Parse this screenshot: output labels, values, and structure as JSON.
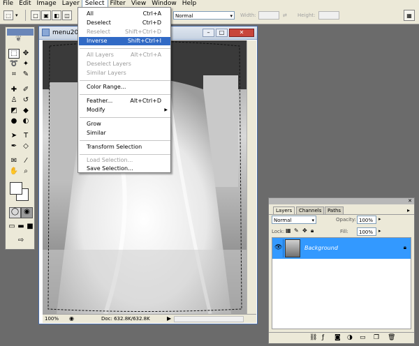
{
  "menubar": {
    "items": [
      "File",
      "Edit",
      "Image",
      "Layer",
      "Select",
      "Filter",
      "View",
      "Window",
      "Help"
    ],
    "active": "Select"
  },
  "options": {
    "style_value": "Normal",
    "width_label": "Width:",
    "height_label": "Height:"
  },
  "document": {
    "title": "menu20",
    "zoom": "100%",
    "doc_info": "Doc: 632.8K/632.8K"
  },
  "select_menu": {
    "items": [
      {
        "label": "All",
        "shortcut": "Ctrl+A",
        "enabled": true
      },
      {
        "label": "Deselect",
        "shortcut": "Ctrl+D",
        "enabled": true
      },
      {
        "label": "Reselect",
        "shortcut": "Shift+Ctrl+D",
        "enabled": false
      },
      {
        "label": "Inverse",
        "shortcut": "Shift+Ctrl+I",
        "enabled": true,
        "highlighted": true
      },
      {
        "label": "All Layers",
        "shortcut": "Alt+Ctrl+A",
        "enabled": false
      },
      {
        "label": "Deselect Layers",
        "shortcut": "",
        "enabled": false
      },
      {
        "label": "Similar Layers",
        "shortcut": "",
        "enabled": false
      },
      {
        "label": "Color Range...",
        "shortcut": "",
        "enabled": true
      },
      {
        "label": "Feather...",
        "shortcut": "Alt+Ctrl+D",
        "enabled": true
      },
      {
        "label": "Modify",
        "shortcut": "",
        "enabled": true,
        "submenu": true
      },
      {
        "label": "Grow",
        "shortcut": "",
        "enabled": true
      },
      {
        "label": "Similar",
        "shortcut": "",
        "enabled": true
      },
      {
        "label": "Transform Selection",
        "shortcut": "",
        "enabled": true
      },
      {
        "label": "Load Selection...",
        "shortcut": "",
        "enabled": false
      },
      {
        "label": "Save Selection...",
        "shortcut": "",
        "enabled": true
      }
    ],
    "submenu_arrow": "▶"
  },
  "layers_panel": {
    "tabs": [
      "Layers",
      "Channels",
      "Paths"
    ],
    "blend_mode": "Normal",
    "opacity_label": "Opacity:",
    "opacity_value": "100%",
    "lock_label": "Lock:",
    "fill_label": "Fill:",
    "fill_value": "100%",
    "layer_name": "Background"
  },
  "colors": {
    "menu_highlight": "#316ac5",
    "layer_selected": "#3399ff"
  }
}
